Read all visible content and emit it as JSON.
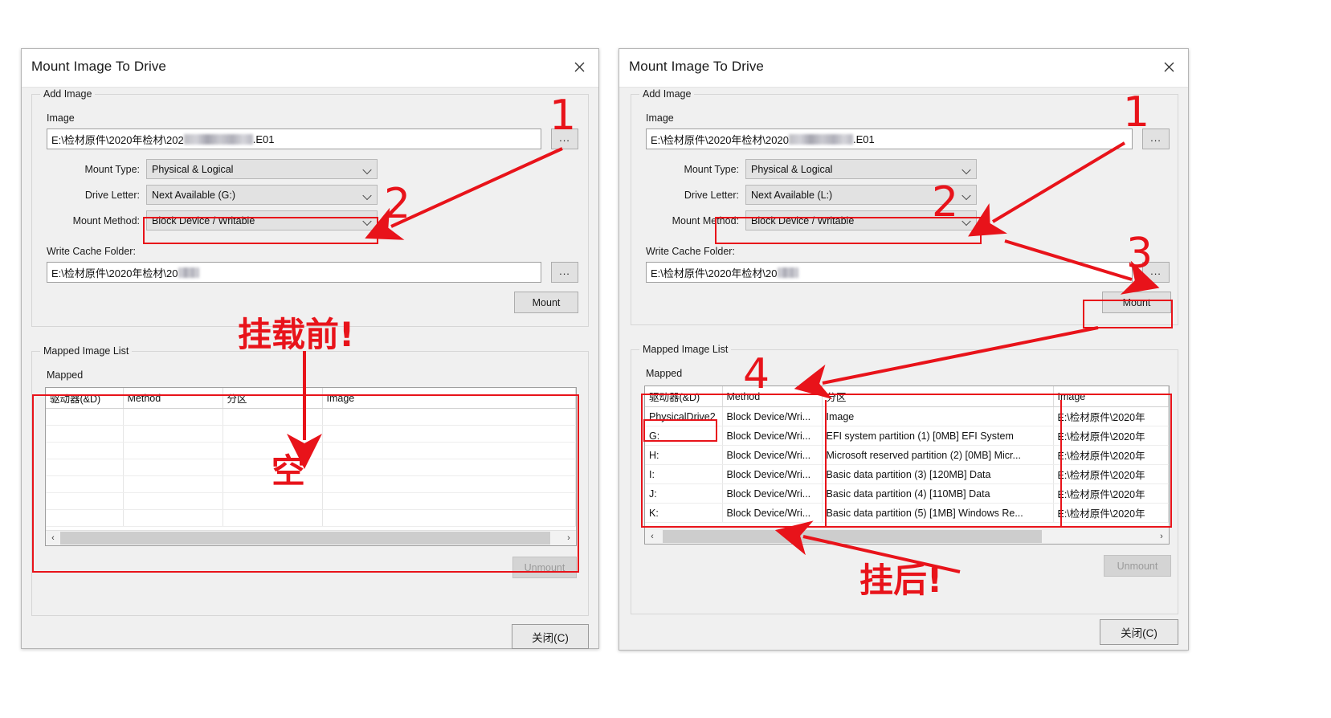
{
  "left_dialog": {
    "title": "Mount Image To Drive",
    "close_icon": "close-x-icon",
    "add_image_group": "Add Image",
    "image_label": "Image",
    "image_value_prefix": "E:\\检材原件\\2020年检材\\202",
    "image_value_suffix": ".E01",
    "browse_label": "...",
    "mount_type_label": "Mount Type:",
    "mount_type_value": "Physical & Logical",
    "drive_letter_label": "Drive Letter:",
    "drive_letter_value": "Next Available (G:)",
    "mount_method_label": "Mount Method:",
    "mount_method_value": "Block Device / Writable",
    "write_cache_label": "Write Cache Folder:",
    "write_cache_value": "E:\\检材原件\\2020年检材\\20",
    "write_cache_browse": "...",
    "mount_button": "Mount",
    "mapped_group": "Mapped Image List",
    "mapped_label": "Mapped",
    "columns": [
      "驱动器(&D)",
      "Method",
      "分区",
      "Image"
    ],
    "rows": [],
    "empty_row_count": 7,
    "scroll_left_arrow": "‹",
    "scroll_right_arrow": "›",
    "unmount_button": "Unmount",
    "close_button": "关闭(C)"
  },
  "right_dialog": {
    "title": "Mount Image To Drive",
    "close_icon": "close-x-icon",
    "add_image_group": "Add Image",
    "image_label": "Image",
    "image_value_prefix": "E:\\检材原件\\2020年检材\\2020",
    "image_value_suffix": ".E01",
    "browse_label": "...",
    "mount_type_label": "Mount Type:",
    "mount_type_value": "Physical & Logical",
    "drive_letter_label": "Drive Letter:",
    "drive_letter_value": "Next Available (L:)",
    "mount_method_label": "Mount Method:",
    "mount_method_value": "Block Device / Writable",
    "write_cache_label": "Write Cache Folder:",
    "write_cache_value": "E:\\检材原件\\2020年检材\\20",
    "write_cache_browse": "...",
    "mount_button": "Mount",
    "mapped_group": "Mapped Image List",
    "mapped_label": "Mapped",
    "columns": [
      "驱动器(&D)",
      "Method",
      "分区",
      "Image"
    ],
    "rows": [
      {
        "drive": "PhysicalDrive2",
        "method": "Block Device/Wri...",
        "partition": "Image",
        "image": "E:\\检材原件\\2020年"
      },
      {
        "drive": "G:",
        "method": "Block Device/Wri...",
        "partition": "EFI system partition (1) [0MB] EFI System",
        "image": "E:\\检材原件\\2020年"
      },
      {
        "drive": "H:",
        "method": "Block Device/Wri...",
        "partition": "Microsoft reserved partition (2) [0MB] Micr...",
        "image": "E:\\检材原件\\2020年"
      },
      {
        "drive": "I:",
        "method": "Block Device/Wri...",
        "partition": "Basic data partition (3) [120MB] Data",
        "image": "E:\\检材原件\\2020年"
      },
      {
        "drive": "J:",
        "method": "Block Device/Wri...",
        "partition": "Basic data partition (4) [110MB] Data",
        "image": "E:\\检材原件\\2020年"
      },
      {
        "drive": "K:",
        "method": "Block Device/Wri...",
        "partition": "Basic data partition (5) [1MB] Windows Re...",
        "image": "E:\\检材原件\\2020年"
      }
    ],
    "scroll_left_arrow": "‹",
    "scroll_right_arrow": "›",
    "unmount_button": "Unmount",
    "close_button": "关闭(C)"
  },
  "annotations": {
    "accent_color": "#e8131a",
    "left": {
      "step1": "1",
      "step2": "2",
      "caption_before": "挂载前!",
      "caption_empty": "空"
    },
    "right": {
      "step1": "1",
      "step2": "2",
      "step3": "3",
      "step4": "4",
      "caption_after": "挂后!"
    }
  }
}
